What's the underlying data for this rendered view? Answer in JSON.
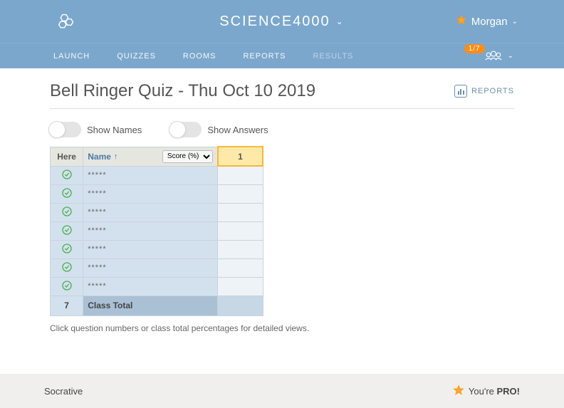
{
  "header": {
    "room_name": "SCIENCE4000",
    "user_name": "Morgan",
    "badge": "1/7"
  },
  "nav": {
    "items": [
      "LAUNCH",
      "QUIZZES",
      "ROOMS",
      "REPORTS",
      "RESULTS"
    ]
  },
  "page": {
    "title": "Bell Ringer Quiz - Thu Oct 10 2019",
    "reports_label": "REPORTS"
  },
  "toggles": {
    "show_names": "Show Names",
    "show_answers": "Show Answers"
  },
  "table": {
    "headers": {
      "here": "Here",
      "name": "Name",
      "score_label": "Score (%)",
      "q1": "1"
    },
    "rows": [
      {
        "present": true,
        "name": "*****"
      },
      {
        "present": true,
        "name": "*****"
      },
      {
        "present": true,
        "name": "*****"
      },
      {
        "present": true,
        "name": "*****"
      },
      {
        "present": true,
        "name": "*****"
      },
      {
        "present": true,
        "name": "*****"
      },
      {
        "present": true,
        "name": "*****"
      }
    ],
    "footer": {
      "count": "7",
      "label": "Class Total"
    },
    "hint": "Click question numbers or class total percentages for detailed views."
  },
  "footer": {
    "brand": "Socrative",
    "pro_prefix": "You're ",
    "pro_bold": "PRO!"
  }
}
